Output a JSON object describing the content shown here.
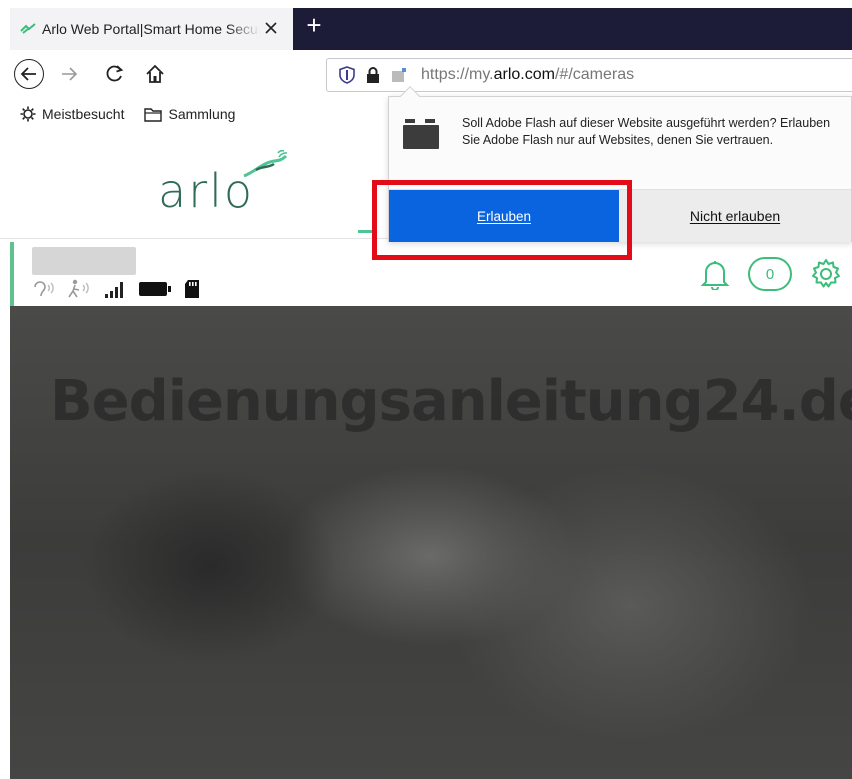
{
  "browser": {
    "tab": {
      "title": "Arlo Web Portal|Smart Home Security"
    },
    "new_tab_label": "+",
    "url": {
      "prefix": "https://my.",
      "domain": "arlo.com",
      "suffix": "/#/cameras"
    },
    "bookmarks": [
      {
        "label": "Meistbesucht",
        "icon": "gear-icon"
      },
      {
        "label": "Sammlung",
        "icon": "folder-icon"
      }
    ]
  },
  "page": {
    "logo_text": "arlo",
    "watermark": "Bedienungsanleitung24.de",
    "camera": {
      "name": "",
      "motion_count": "0",
      "status_icons": [
        "audio-icon",
        "motion-icon",
        "signal-icon",
        "battery-icon",
        "sd-card-icon"
      ]
    }
  },
  "flash_prompt": {
    "message": "Soll Adobe Flash auf dieser Website ausgeführt werden? Erlauben Sie Adobe Flash nur auf Websites, denen Sie vertrauen.",
    "allow_label": "Erlauben",
    "deny_label": "Nicht erlauben"
  },
  "colors": {
    "accent_green": "#3bbd7c",
    "allow_blue": "#0a64e0",
    "highlight_red": "#e30b17",
    "tabbar_dark": "#1c1b38"
  }
}
